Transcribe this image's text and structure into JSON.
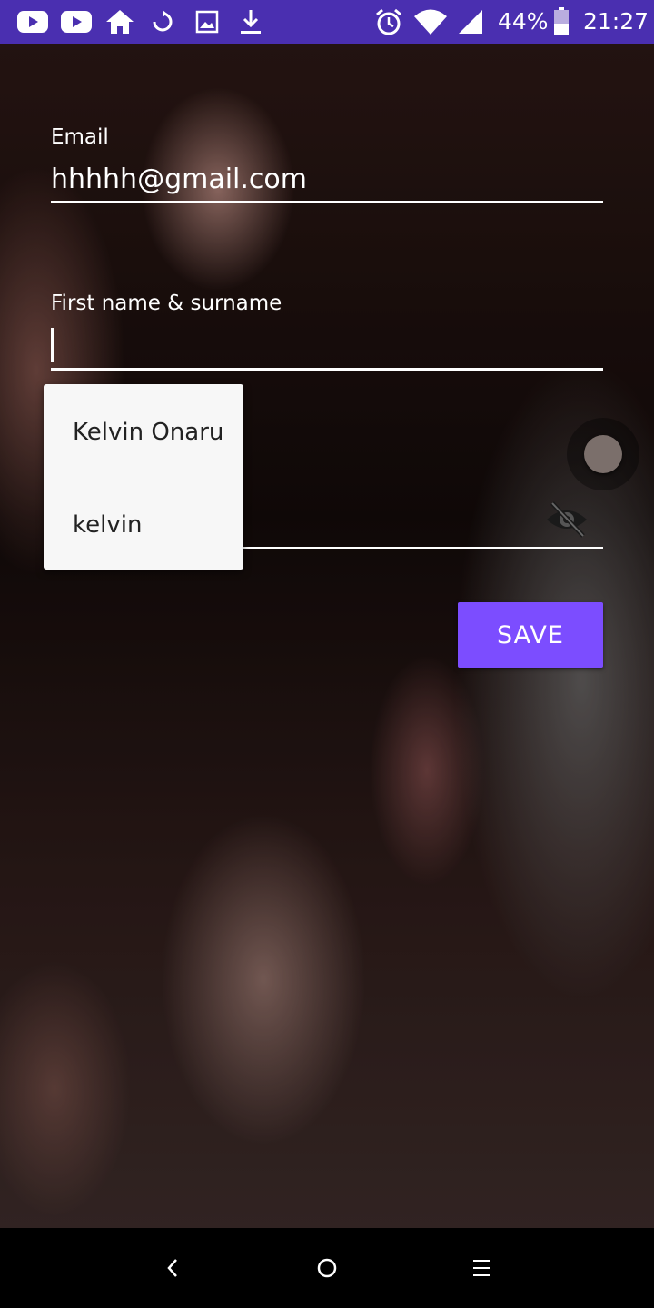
{
  "status_bar": {
    "icons": [
      "youtube-icon",
      "youtube-icon",
      "home-icon",
      "refresh-icon",
      "image-icon",
      "download-icon",
      "alarm-icon",
      "wifi-icon",
      "signal-icon",
      "battery-icon"
    ],
    "battery_percent": "44%",
    "time": "21:27",
    "background_color": "#4a2fb0"
  },
  "form": {
    "email_label": "Email",
    "email_value": "hhhhh@gmail.com",
    "name_label": "First name & surname",
    "name_value": "",
    "password_visibility_icon": "eye-off-icon",
    "save_label": "SAVE",
    "accent_color": "#7c4dff"
  },
  "autocomplete": {
    "items": [
      "Kelvin Onaru",
      "kelvin"
    ]
  },
  "nav_bar": {
    "icons": [
      "back-icon",
      "home-circle-icon",
      "menu-icon"
    ]
  }
}
